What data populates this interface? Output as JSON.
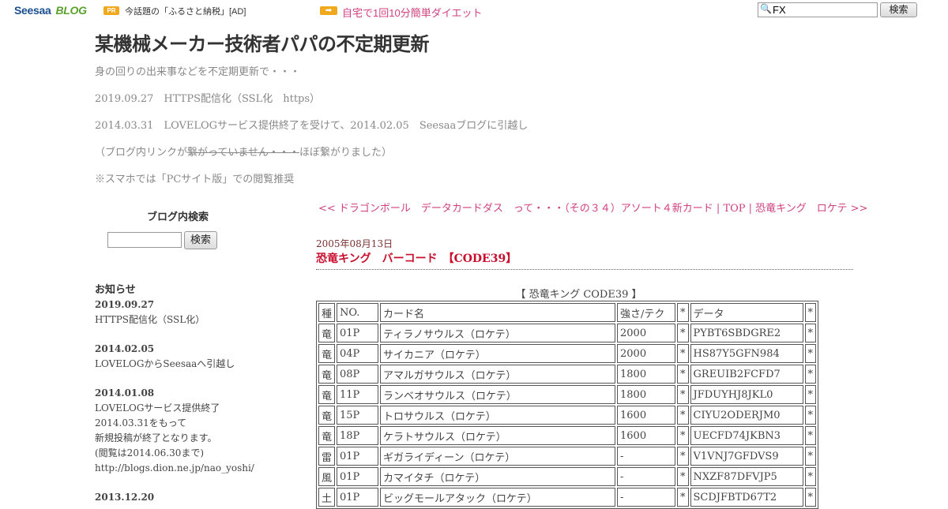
{
  "topbar": {
    "logo_seesaa": "Seesaa",
    "logo_blog": "BLOG",
    "pr_badge": "PR",
    "pr_text": "今話題の「ふるさと納税」[AD]",
    "arrow_badge": "➡",
    "ad_link": "自宅で1回10分簡単ダイエット",
    "search_value": "FX",
    "search_button": "検索"
  },
  "header": {
    "title": "某機械メーカー技術者パパの不定期更新",
    "tagline": "身の回りの出来事などを不定期更新で・・・",
    "line1": "2019.09.27　HTTPS配信化（SSL化　https）",
    "line2": "2014.03.31　LOVELOGサービス提供終了を受けて、2014.02.05　Seesaaブログに引越し",
    "line3_pre": "（ブログ内リンクが",
    "line3_strike": "繋がっていません・・・",
    "line3_post": "ほぼ繋がりました）",
    "line4": "※スマホでは「PCサイト版」での閲覧推奨"
  },
  "sidebar": {
    "search_title": "ブログ内検索",
    "search_button": "検索",
    "notice_heading": "お知らせ",
    "notices": [
      {
        "date": "2019.09.27",
        "lines": [
          "HTTPS配信化（SSL化）"
        ]
      },
      {
        "date": "2014.02.05",
        "lines": [
          "LOVELOGからSeesaaへ引越し"
        ]
      },
      {
        "date": "2014.01.08",
        "lines": [
          "LOVELOGサービス提供終了",
          "2014.03.31をもって",
          "新規投稿が終了となります。",
          "(閲覧は2014.06.30まで)",
          "http://blogs.dion.ne.jp/nao_yoshi/"
        ]
      }
    ],
    "notice_partial_date": "2013.12.20"
  },
  "nav": {
    "prev": "<< ドラゴンボール　データカードダス　って・・・（その３４）アソート４新カード",
    "sep1": " | ",
    "top": "TOP",
    "sep2": " | ",
    "next": "恐竜キング　ロケテ >>"
  },
  "post": {
    "date": "2005年08月13日",
    "title": "恐竜キング　バーコード　【CODE39】",
    "table_caption": "【 恐竜キング CODE39 】",
    "columns": [
      "種",
      "NO.",
      "カード名",
      "強さ/テク",
      "*",
      "データ",
      "*"
    ],
    "rows": [
      [
        "竜",
        "01P",
        "ティラノサウルス（ロケテ）",
        "2000",
        "*",
        "PYBT6SBDGRE2",
        "*"
      ],
      [
        "竜",
        "04P",
        "サイカニア（ロケテ）",
        "2000",
        "*",
        "HS87Y5GFN984",
        "*"
      ],
      [
        "竜",
        "08P",
        "アマルガサウルス（ロケテ）",
        "1800",
        "*",
        "GREUIB2FCFD7",
        "*"
      ],
      [
        "竜",
        "11P",
        "ランベオサウルス（ロケテ）",
        "1800",
        "*",
        "JFDUYHJ8JKL0",
        "*"
      ],
      [
        "竜",
        "15P",
        "トロサウルス（ロケテ）",
        "1600",
        "*",
        "CIYU2ODERJM0",
        "*"
      ],
      [
        "竜",
        "18P",
        "ケラトサウルス（ロケテ）",
        "1600",
        "*",
        "UECFD74JKBN3",
        "*"
      ],
      [
        "雷",
        "01P",
        "ギガライディーン（ロケテ）",
        "-",
        "*",
        "V1VNJ7GFDVS9",
        "*"
      ],
      [
        "風",
        "01P",
        "カマイタチ（ロケテ）",
        "-",
        "*",
        "NXZF87DFVJP5",
        "*"
      ],
      [
        "土",
        "01P",
        "ビッグモールアタック（ロケテ）",
        "-",
        "*",
        "SCDJFBTD67T2",
        "*"
      ]
    ]
  }
}
